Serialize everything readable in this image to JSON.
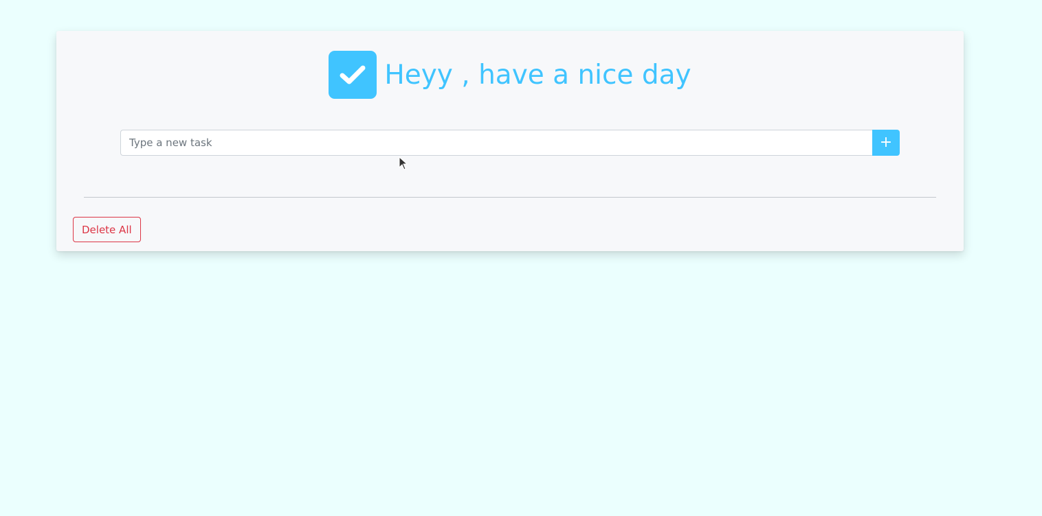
{
  "header": {
    "title": "Heyy , have a nice day",
    "logo_icon": "check-square-icon"
  },
  "task_form": {
    "placeholder": "Type a new task",
    "value": "",
    "add_button_label": "+"
  },
  "actions": {
    "delete_all_label": "Delete All"
  },
  "colors": {
    "page_background": "#ebfffe",
    "card_background": "#f7f8fa",
    "accent": "#40c4ff",
    "danger": "#dc3545"
  }
}
